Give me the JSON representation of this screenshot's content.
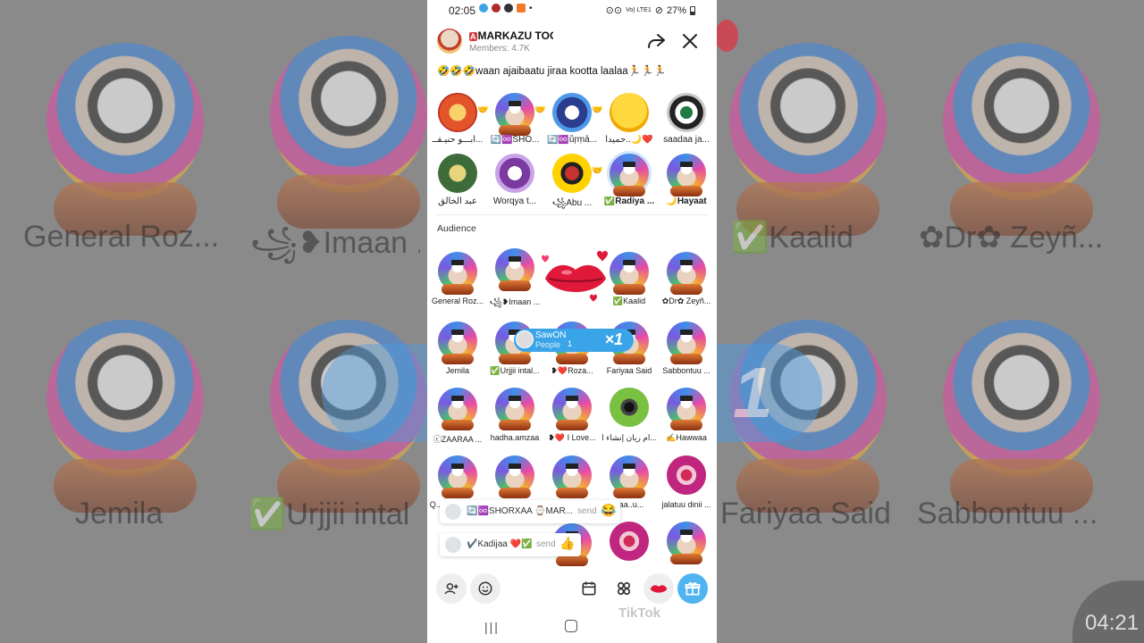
{
  "status": {
    "time": "02:05",
    "battery": "27%",
    "signal_labels": "Vo) LTE1"
  },
  "room": {
    "title": "MARKAZU TOC",
    "title_badge": "A",
    "members": "Members: 4.7K",
    "description": "🤣🤣🤣waan ajaibaatu jiraa kootta laalaa🏃🏃🏃"
  },
  "speakers": [
    {
      "name": "ابـــو حنيـفــ..."
    },
    {
      "name": "🔄♾️SHO..."
    },
    {
      "name": "🔄♾️ůŗṃả..."
    },
    {
      "name": "حميدا..🌙❤️"
    },
    {
      "name": "saadaa ja..."
    },
    {
      "name": "عبد الخالق"
    },
    {
      "name": "Worqya  t..."
    },
    {
      "name": "꧁Abu ..."
    },
    {
      "name": "✅Radiya ..."
    },
    {
      "name": "🌙Hayaat"
    }
  ],
  "audience_label": "Audience",
  "audience": [
    {
      "name": "General Roz..."
    },
    {
      "name": "꧁❥Imaan ..."
    },
    {
      "name": ""
    },
    {
      "name": "✅Kaalid"
    },
    {
      "name": "✿Dr✿ Zeyñ..."
    },
    {
      "name": "Jemila"
    },
    {
      "name": "✅Urjjii intal..."
    },
    {
      "name": "❥❤️Roza..."
    },
    {
      "name": "Fariyaa  Said"
    },
    {
      "name": "Sabbontuu ..."
    },
    {
      "name": "ⓒZAARAA ..."
    },
    {
      "name": "hadha.amzaa"
    },
    {
      "name": "❥❤️ I Love..."
    },
    {
      "name": "ام ريان إنشاء ا..."
    },
    {
      "name": "✍️Hawwaa"
    },
    {
      "name": "Q..."
    },
    {
      "name": ""
    },
    {
      "name": ""
    },
    {
      "name": "naa..u..."
    },
    {
      "name": "jalatuu dinii ..."
    }
  ],
  "gift_banner": {
    "sender": "SawON",
    "subtitle": "People",
    "mini": "1",
    "count": "×1"
  },
  "toasts": [
    {
      "text": "🔄♾️SHORXAA ⌚MAR...",
      "send": "send",
      "gift": "😂"
    },
    {
      "text": "✔️Kadijaa ❤️✅",
      "send": "send",
      "gift": "👍"
    }
  ],
  "bottom_bar": {
    "add_friend_icon": "add-member-icon",
    "emoji_icon": "emoji-icon",
    "calendar_icon": "calendar-icon",
    "grid_icon": "more-grid-icon",
    "lips_icon": "kiss-gift-icon",
    "gift_icon": "gift-box-icon"
  },
  "watermark": "TikTok",
  "background": {
    "names": [
      "General Roz...",
      "꧁❥Imaan ...",
      "✅Kaalid",
      "✿Dr✿ Zeyñ...",
      "Jemila",
      "✅Urjjii intal",
      "Fariyaa  Said",
      "Sabbontuu ..."
    ],
    "big_count": "1",
    "corner_time": "04:21"
  },
  "colors": {
    "accent_blue": "#3aa4e9",
    "gift_button": "#4fb4ef",
    "kiss_red": "#e0193a"
  }
}
